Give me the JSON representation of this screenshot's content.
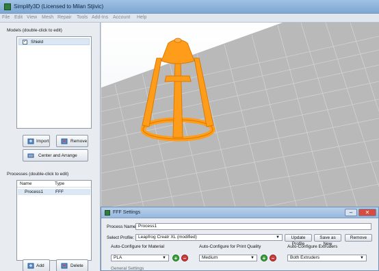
{
  "window": {
    "title": "Simplify3D (Licensed to Milan Stjivic)"
  },
  "menu": [
    "File",
    "Edit",
    "View",
    "Mesh",
    "Repair",
    "Tools",
    "Add-Ins",
    "Account",
    "Help"
  ],
  "models": {
    "section_label": "Models (double-click to edit)",
    "items": [
      {
        "name": "Shield",
        "checked": true
      }
    ],
    "import_label": "Import",
    "remove_label": "Remove",
    "center_label": "Center and Arrange"
  },
  "processes": {
    "section_label": "Processes (double-click to edit)",
    "col_name": "Name",
    "col_type": "Type",
    "rows": [
      {
        "name": "Process1",
        "type": "FFF"
      }
    ],
    "add_label": "Add",
    "delete_label": "Delete"
  },
  "dialog": {
    "title": "FFF Settings",
    "process_name_label": "Process Name:",
    "process_name_value": "Process1",
    "select_profile_label": "Select Profile:",
    "select_profile_value": "Leapfrog Creatr XL (modified)",
    "update_profile_label": "Update Profile",
    "save_as_new_label": "Save as New",
    "remove_label": "Remove",
    "auto_material_label": "Auto-Configure for Material",
    "auto_material_value": "PLA",
    "auto_quality_label": "Auto-Configure for Print Quality",
    "auto_quality_value": "Medium",
    "auto_extruders_label": "Auto-Configure Extruders",
    "auto_extruders_value": "Both Extruders",
    "general_settings_label": "General Settings"
  },
  "colors": {
    "part": "#ff9c1a",
    "accent": "#6d8fb7"
  }
}
